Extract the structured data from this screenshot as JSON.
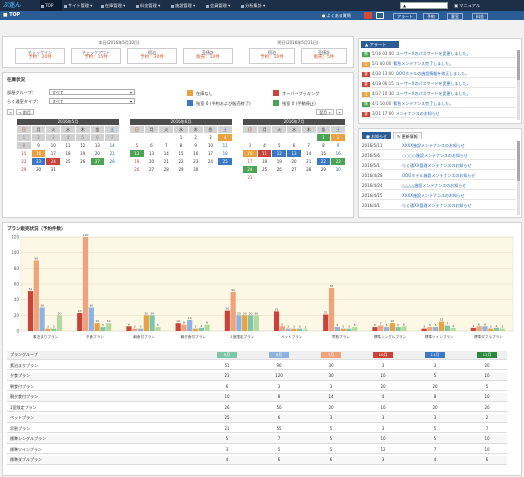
{
  "nav": {
    "logo": "ぶ迷ん",
    "items": [
      {
        "label": "TOP"
      },
      {
        "label": "サイト管理 ▾"
      },
      {
        "label": "在庫管理 ▾"
      },
      {
        "label": "料金管理 ▾"
      },
      {
        "label": "施設管理 ▾"
      },
      {
        "label": "会員管理 ▾"
      },
      {
        "label": "分析集計 ▾"
      }
    ],
    "user": "▲",
    "manual": "マニュアル"
  },
  "titlebar": {
    "title": "TOP",
    "items": [
      "よくある質問",
      "アラート",
      "予約",
      "客室",
      "料金"
    ]
  },
  "summary": {
    "today_title": "本日(2016年5月10日)",
    "tomorrow_title": "明日(2016年5月11日)",
    "boxes": [
      {
        "label": "チェックイン",
        "value": "予約：20件"
      },
      {
        "label": "チェックアウト",
        "value": "予約：15件"
      },
      {
        "label": "宿泊",
        "value": "予約：30件"
      },
      {
        "label": "売値計",
        "value": "販売：10件"
      },
      {
        "label": "宿泊",
        "value": "予約：10件"
      },
      {
        "label": "売値計",
        "value": "販売：5件"
      }
    ]
  },
  "stock": {
    "title": "在庫状況",
    "group_label": "部屋グループ：",
    "group_value": "すべて",
    "type_label": "らく通室タイプ：",
    "type_value": "すべて",
    "legends": [
      {
        "label": "在庫なし",
        "color": "#e9a141"
      },
      {
        "label": "オーバーブッキング",
        "color": "#c9433a"
      },
      {
        "label": "残室 0 (予約および販売終了)",
        "color": "#3b77c3"
      },
      {
        "label": "残室 0 (手動停止)",
        "color": "#4aa454"
      }
    ],
    "prev_label": "« 前月",
    "next_label": "翌月 »"
  },
  "calendars": [
    {
      "title": "2016年5月"
    },
    {
      "title": "2016年6月"
    },
    {
      "title": "2016年7月"
    }
  ],
  "weekdays": [
    "日",
    "月",
    "火",
    "水",
    "木",
    "金",
    "土"
  ],
  "alerts": {
    "title": "アラート",
    "rows": [
      {
        "badge": "g",
        "time": "5/16 03:00",
        "msg": "ユーザーXのパスワードを変更しました。"
      },
      {
        "badge": "o",
        "time": "5/1 00:00",
        "msg": "緊急メンテナンス完了しました。"
      },
      {
        "badge": "r",
        "time": "4/30 13:00",
        "msg": "OOOホテルの施設情報を修正しました。"
      },
      {
        "badge": "r",
        "time": "4/18 06:15",
        "msg": "ユーザーXのパスワードを変更しました。"
      },
      {
        "badge": "o",
        "time": "4/17 10:30",
        "msg": "ユーザーXのパスワードを変更しました。"
      },
      {
        "badge": "g",
        "time": "4/1 10:00",
        "msg": "緊急メンテナンス完了しました。"
      },
      {
        "badge": "r",
        "time": "3/31 17:00",
        "msg": "メンテナンスのお知らせ"
      }
    ]
  },
  "news": {
    "tab_active": "お知らせ",
    "tab_other": "更新情報",
    "rows": [
      {
        "date": "2016/5/11",
        "title": "XXXX施設メンテナンスのお知らせ"
      },
      {
        "date": "2016/5/6",
        "title": "○○○○施設メンテナンスのお知らせ"
      },
      {
        "date": "2016/5/1",
        "title": "らく通XX管理メンテナンスのお知らせ"
      },
      {
        "date": "2016/4/28",
        "title": "OOOホテル施設メンテナンスのお知らせ"
      },
      {
        "date": "2016/4/24",
        "title": "△△△△施設メンテナンスのお知らせ"
      },
      {
        "date": "2016/4/15",
        "title": "XXXX施設メンテナンスのお知らせ"
      },
      {
        "date": "2016/4/1",
        "title": "らく通XX管理メンテナンスのお知らせ"
      }
    ]
  },
  "plan_section": {
    "title": "プラン販売状況（予約件数）",
    "table_header": "プラングループ",
    "month_labels": [
      "5月",
      "6月",
      "7月",
      "10月",
      "11月",
      "12月"
    ],
    "month_colors": [
      "#7fc6a8",
      "#8fb3de",
      "#f0a37a",
      "#c9433a",
      "#3b77c3",
      "#2e8a3e"
    ]
  },
  "chart_data": {
    "type": "bar",
    "ylim": [
      0,
      120
    ],
    "yticks": [
      0,
      20,
      40,
      60,
      80,
      100,
      120
    ],
    "categories": [
      "素泊まりプラン",
      "夕食プラン",
      "朝食付プラン",
      "朝夕食付プラン",
      "1室限定プラン",
      "ペットプラン",
      "早割プラン",
      "標準シングルプラン",
      "標準ツインプラン",
      "標準ダブルプラン"
    ],
    "series": [
      {
        "name": "5月",
        "color": "#c9433a",
        "values": [
          51,
          23,
          6,
          10,
          26,
          25,
          21,
          5,
          3,
          4
        ]
      },
      {
        "name": "6月",
        "color": "#f0a37a",
        "values": [
          90,
          120,
          3,
          8,
          50,
          6,
          55,
          7,
          5,
          6
        ]
      },
      {
        "name": "7月",
        "color": "#8fb3de",
        "values": [
          30,
          30,
          3,
          14,
          20,
          3,
          5,
          5,
          5,
          6
        ]
      },
      {
        "name": "10月",
        "color": "#e9a141",
        "values": [
          3,
          10,
          20,
          3,
          20,
          3,
          3,
          10,
          12,
          3
        ]
      },
      {
        "name": "11月",
        "color": "#7fc6a8",
        "values": [
          3,
          5,
          20,
          4,
          20,
          3,
          3,
          5,
          7,
          4
        ]
      },
      {
        "name": "12月",
        "color": "#b3d9a0",
        "values": [
          20,
          10,
          5,
          8,
          20,
          2,
          5,
          6,
          4,
          3
        ]
      }
    ]
  },
  "table": {
    "rows": [
      {
        "name": "素泊まりプラン",
        "vals": [
          "51",
          "90",
          "30",
          "3",
          "3",
          "20"
        ]
      },
      {
        "name": "夕食プラン",
        "vals": [
          "23",
          "120",
          "30",
          "10",
          "5",
          "10"
        ]
      },
      {
        "name": "朝食付プラン",
        "vals": [
          "6",
          "3",
          "3",
          "20",
          "20",
          "5"
        ]
      },
      {
        "name": "朝夕食付プラン",
        "vals": [
          "10",
          "8",
          "14",
          "4",
          "8",
          "10"
        ]
      },
      {
        "name": "1室限定プラン",
        "vals": [
          "26",
          "50",
          "20",
          "10",
          "20",
          "20"
        ]
      },
      {
        "name": "ペットプラン",
        "vals": [
          "25",
          "6",
          "3",
          "3",
          "3",
          "2"
        ]
      },
      {
        "name": "早割プラン",
        "vals": [
          "21",
          "55",
          "5",
          "3",
          "5",
          "7"
        ]
      },
      {
        "name": "標準シングルプラン",
        "vals": [
          "5",
          "7",
          "5",
          "10",
          "5",
          "10"
        ]
      },
      {
        "name": "標準ツインプラン",
        "vals": [
          "3",
          "5",
          "5",
          "12",
          "7",
          "10"
        ]
      },
      {
        "name": "標準ダブルプラン",
        "vals": [
          "4",
          "6",
          "6",
          "3",
          "4",
          "6"
        ]
      }
    ]
  }
}
